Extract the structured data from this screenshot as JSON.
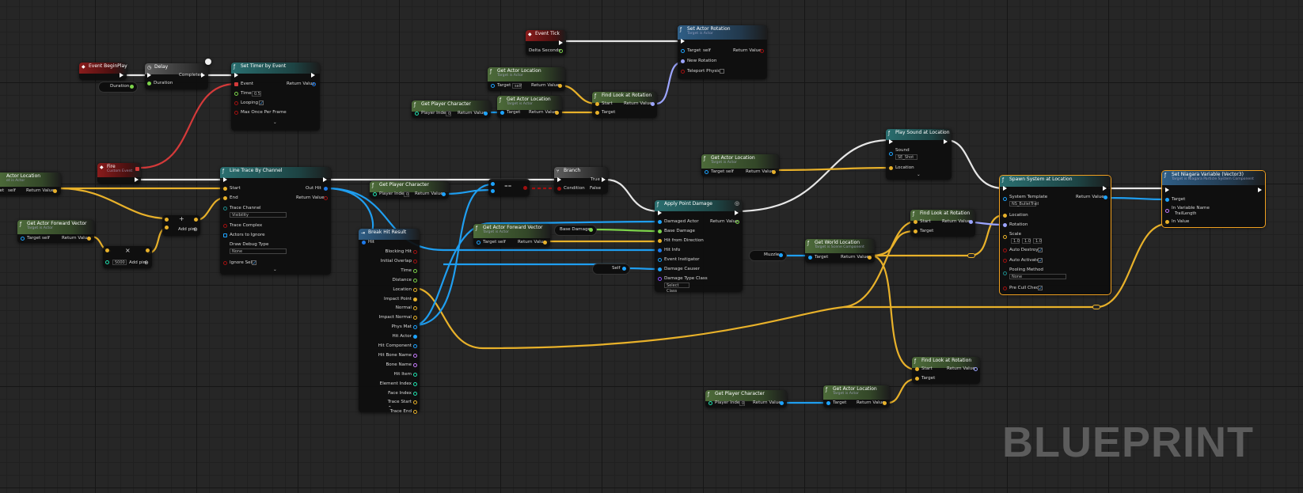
{
  "watermark": "BLUEPRINT",
  "colors": {
    "exec": "#ffffff",
    "object": "#1da3ff",
    "vector": "#f0b429",
    "rotator": "#9ca5ff",
    "bool": "#940000",
    "event": "#ff3838",
    "struct": "#1e7aeb",
    "float": "#9bf100",
    "name": "#c87cff",
    "int": "#20e2b0",
    "vec_green": "#5fd04f"
  },
  "nodes": {
    "begin_play": {
      "title": "Event BeginPlay"
    },
    "delay": {
      "title": "Delay",
      "completed": "Completed",
      "duration": "Duration"
    },
    "duration_var": {
      "label": "Duration"
    },
    "set_timer": {
      "title": "Set Timer by Event",
      "event": "Event",
      "return_value": "Return Value",
      "time": "Time",
      "time_value": "0.5",
      "looping": "Looping",
      "max_once": "Max Once Per Frame"
    },
    "fire": {
      "title": "Fire",
      "subtitle": "Custom Event"
    },
    "get_actor_location_left": {
      "title": "Actor Location",
      "subtitle": "et is Actor",
      "target": "get",
      "target_value": "self",
      "return_value": "Return Value"
    },
    "get_fwd_vec_left": {
      "title": "Get Actor Forward Vector",
      "subtitle": "Target is Actor",
      "target": "Target",
      "target_value": "self",
      "return_value": "Return Value"
    },
    "mult_node": {
      "value": "5000",
      "add_pin": "Add pin",
      "symbol": "×"
    },
    "add_node": {
      "add_pin": "Add pin",
      "symbol": "+"
    },
    "line_trace": {
      "title": "Line Trace By Channel",
      "start": "Start",
      "end": "End",
      "out_hit": "Out Hit",
      "return_value": "Return Value",
      "trace_channel": "Trace Channel",
      "trace_channel_value": "Visibility",
      "trace_complex": "Trace Complex",
      "actors_to_ignore": "Actors to Ignore",
      "draw_debug": "Draw Debug Type",
      "draw_debug_value": "None",
      "ignore_self": "Ignore Self"
    },
    "break_hit": {
      "title": "Break Hit Result",
      "hit": "Hit",
      "pins": [
        "Blocking Hit",
        "Initial Overlap",
        "Time",
        "Distance",
        "Location",
        "Impact Point",
        "Normal",
        "Impact Normal",
        "Phys Mat",
        "Hit Actor",
        "Hit Component",
        "Hit Bone Name",
        "Bone Name",
        "Hit Item",
        "Element Index",
        "Face Index",
        "Trace Start",
        "Trace End"
      ]
    },
    "get_player_char_mid": {
      "title": "Get Player Character",
      "player_index": "Player Index",
      "index_value": "0",
      "return_value": "Return Value"
    },
    "equal_node": {
      "symbol": "=="
    },
    "branch": {
      "title": "Branch",
      "condition": "Condition",
      "true": "True",
      "false": "False"
    },
    "get_fwd_vec_mid": {
      "title": "Get Actor Forward Vector",
      "subtitle": "Target is Actor",
      "target": "Target",
      "target_value": "self",
      "return_value": "Return Value"
    },
    "base_damage_var": {
      "label": "Base Damage"
    },
    "self_node": {
      "label": "Self"
    },
    "apply_damage": {
      "title": "Apply Point Damage",
      "damaged_actor": "Damaged Actor",
      "return_value": "Return Value",
      "base_damage": "Base Damage",
      "hit_from": "Hit from Direction",
      "hit_info": "Hit Info",
      "event_instigator": "Event Instigator",
      "damage_causer": "Damage Causer",
      "damage_type": "Damage Type Class",
      "damage_type_value": "Select Class"
    },
    "event_tick": {
      "title": "Event Tick",
      "delta": "Delta Seconds"
    },
    "set_actor_rot": {
      "title": "Set Actor Rotation",
      "subtitle": "Target is Actor",
      "target": "Target",
      "target_value": "self",
      "return_value": "Return Value",
      "new_rotation": "New Rotation",
      "teleport": "Teleport Physics"
    },
    "get_actor_loc_top": {
      "title": "Get Actor Location",
      "subtitle": "Target is Actor",
      "target": "Target",
      "target_value": "self",
      "return_value": "Return Value"
    },
    "get_player_char_top": {
      "title": "Get Player Character",
      "player_index": "Player Index",
      "index_value": "0",
      "return_value": "Return Value"
    },
    "get_actor_loc_top2": {
      "title": "Get Actor Location",
      "subtitle": "Target is Actor",
      "target": "Target",
      "return_value": "Return Value"
    },
    "find_look_top": {
      "title": "Find Look at Rotation",
      "start": "Start",
      "target": "Target",
      "return_value": "Return Value"
    },
    "get_actor_loc_sound": {
      "title": "Get Actor Location",
      "subtitle": "Target is Actor",
      "target": "Target",
      "target_value": "self",
      "return_value": "Return Value"
    },
    "play_sound": {
      "title": "Play Sound at Location",
      "sound": "Sound",
      "sound_value": "SE_Shot",
      "location": "Location"
    },
    "find_look_mid": {
      "title": "Find Look at Rotation",
      "start": "Start",
      "target": "Target",
      "return_value": "Return Value"
    },
    "muzzle_var": {
      "label": "Muzzle"
    },
    "get_world_loc": {
      "title": "Get World Location",
      "subtitle": "Target is Scene Component",
      "target": "Target",
      "return_value": "Return Value"
    },
    "spawn_system": {
      "title": "Spawn System at Location",
      "system_template": "System Template",
      "template_value": "NS_BulletTrail",
      "return_value": "Return Value",
      "location": "Location",
      "rotation": "Rotation",
      "scale": "Scale",
      "scale_x": "1.0",
      "scale_y": "1.0",
      "scale_z": "1.0",
      "auto_destroy": "Auto Destroy",
      "auto_activate": "Auto Activate",
      "pooling": "Pooling Method",
      "pooling_value": "None",
      "pre_cull": "Pre Cull Check"
    },
    "set_niagara": {
      "title": "Set Niagara Variable (Vector3)",
      "subtitle": "Target is Niagara Particle System Component",
      "target": "Target",
      "var_name": "In Variable Name",
      "var_value": "TrailLength",
      "in_value": "In Value"
    },
    "find_look_bottom": {
      "title": "Find Look at Rotation",
      "start": "Start",
      "target": "Target",
      "return_value": "Return Value"
    },
    "get_player_char_bottom": {
      "title": "Get Player Character",
      "player_index": "Player Index",
      "index_value": "0",
      "return_value": "Return Value"
    },
    "get_actor_loc_bottom": {
      "title": "Get Actor Location",
      "subtitle": "Target is Actor",
      "target": "Target",
      "return_value": "Return Value"
    }
  }
}
